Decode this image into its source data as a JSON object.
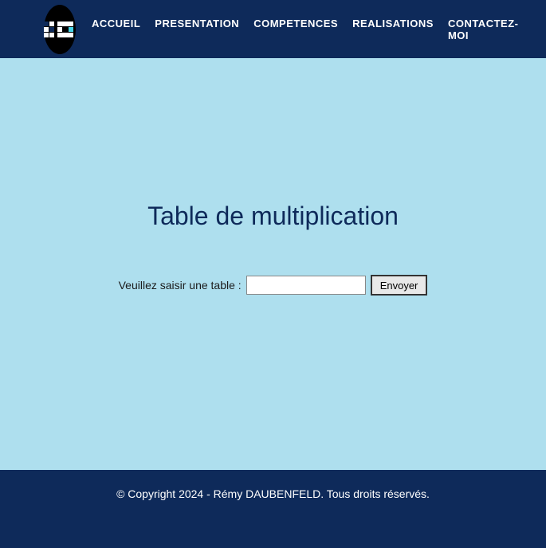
{
  "nav": {
    "items": [
      {
        "label": "ACCUEIL"
      },
      {
        "label": "PRESENTATION"
      },
      {
        "label": "COMPETENCES"
      },
      {
        "label": "REALISATIONS"
      },
      {
        "label": "CONTACTEZ-MOI"
      }
    ]
  },
  "main": {
    "title": "Table de multiplication",
    "form_label": "Veuillez saisir une table :",
    "submit_label": "Envoyer"
  },
  "footer": {
    "copyright": "© Copyright 2024 - Rémy DAUBENFELD. Tous droits réservés."
  }
}
